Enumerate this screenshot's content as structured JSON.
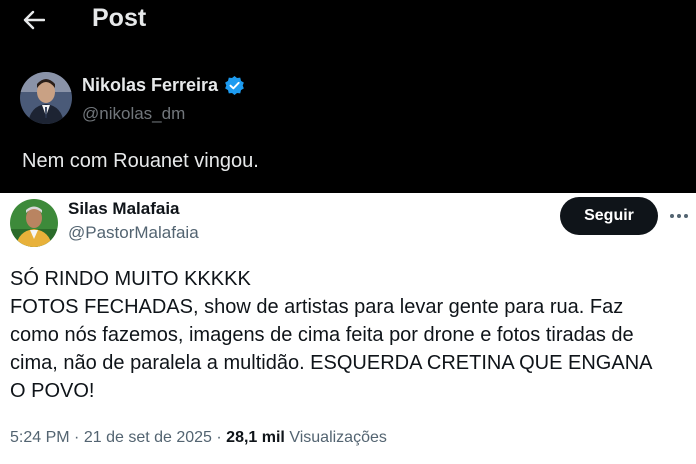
{
  "header": {
    "title": "Post",
    "back_icon": "arrow-left-icon"
  },
  "post_top": {
    "name": "Nikolas Ferreira",
    "handle": "@nikolas_dm",
    "verified_icon": "verified-badge-icon",
    "verified_color": "#1d9bf0",
    "text": "Nem com Rouanet vingou."
  },
  "post_quoted": {
    "name": "Silas Malafaia",
    "handle": "@PastorMalafaia",
    "follow_label": "Seguir",
    "more_icon": "more-horizontal-icon",
    "lines": [
      "SÓ RINDO MUITO KKKKK",
      "FOTOS FECHADAS, show de artistas para levar gente para rua. Faz",
      "como nós fazemos, imagens de cima feita por drone e fotos tiradas de",
      "cima, não de paralela a multidão. ESQUERDA CRETINA QUE ENGANA",
      "O POVO!"
    ],
    "time": "5:24 PM",
    "separator": "·",
    "date": "21 de set de 2025",
    "views_count": "28,1 mil",
    "views_label": "Visualizações"
  },
  "colors": {
    "dark_bg": "#000000",
    "dark_text": "#e7e9ea",
    "muted_dark": "#71767b",
    "muted_light": "#536471",
    "follow_bg": "#0f1419"
  }
}
